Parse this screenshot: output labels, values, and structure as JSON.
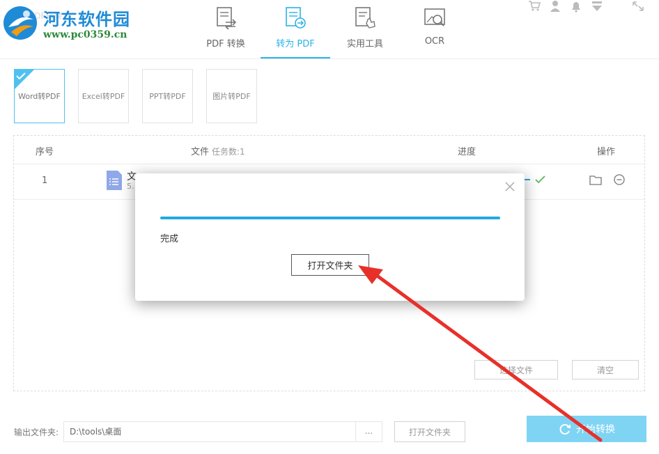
{
  "header": {
    "logo_title": "河东软件园",
    "logo_url": "www.pc0359.cn",
    "faded_title": "PDF转换",
    "tabs": [
      {
        "label": "PDF 转换",
        "icon": "pdf-convert-icon",
        "active": false
      },
      {
        "label": "转为 PDF",
        "icon": "to-pdf-icon",
        "active": true
      },
      {
        "label": "实用工具",
        "icon": "tools-icon",
        "active": false
      },
      {
        "label": "OCR",
        "icon": "ocr-icon",
        "active": false
      }
    ],
    "window_icons": [
      "cart-icon",
      "user-icon",
      "bell-icon",
      "dropdown-icon",
      "maximize-icon"
    ]
  },
  "subtabs": [
    {
      "label": "Word转PDF",
      "active": true
    },
    {
      "label": "Excel转PDF",
      "active": false
    },
    {
      "label": "PPT转PDF",
      "active": false
    },
    {
      "label": "图片转PDF",
      "active": false
    }
  ],
  "table": {
    "headers": {
      "index": "序号",
      "file": "文件",
      "task_count": "任务数:1",
      "progress": "进度",
      "actions": "操作"
    },
    "rows": [
      {
        "index": "1",
        "file_name": "文",
        "file_size": "5.",
        "status": "done"
      }
    ],
    "select_files_label": "选择文件",
    "clear_label": "清空"
  },
  "output": {
    "label": "输出文件夹:",
    "path": "D:\\tools\\桌面",
    "browse_label": "...",
    "open_folder_label": "打开文件夹"
  },
  "start_label": "开始转换",
  "modal": {
    "progress": 1.0,
    "status": "完成",
    "open_folder_label": "打开文件夹"
  },
  "colors": {
    "accent": "#2bb2e8",
    "progress": "#1fa9e1",
    "start_button": "#7fd4f4",
    "arrow": "#e8302a",
    "check": "#5cb85c"
  }
}
